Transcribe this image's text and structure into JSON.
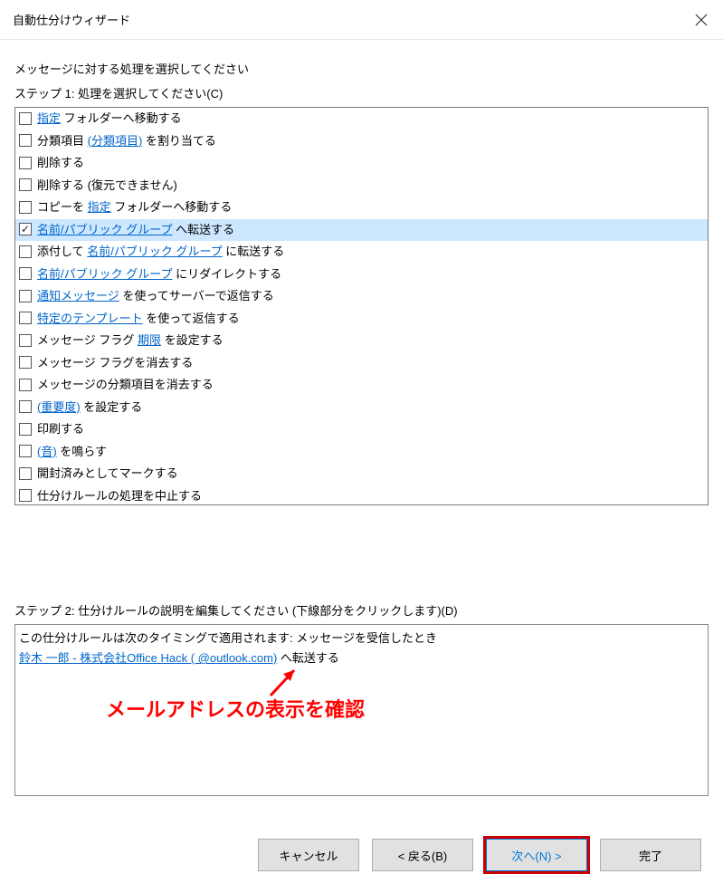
{
  "title": "自動仕分けウィザード",
  "instruction": "メッセージに対する処理を選択してください",
  "step1_label": "ステップ 1: 処理を選択してください(C)",
  "actions": [
    {
      "checked": false,
      "selected": false,
      "parts": [
        {
          "t": "link",
          "v": "指定"
        },
        {
          "t": "text",
          "v": " フォルダーへ移動する"
        }
      ]
    },
    {
      "checked": false,
      "selected": false,
      "parts": [
        {
          "t": "text",
          "v": "分類項目 "
        },
        {
          "t": "link",
          "v": "(分類項目)"
        },
        {
          "t": "text",
          "v": " を割り当てる"
        }
      ]
    },
    {
      "checked": false,
      "selected": false,
      "parts": [
        {
          "t": "text",
          "v": "削除する"
        }
      ]
    },
    {
      "checked": false,
      "selected": false,
      "parts": [
        {
          "t": "text",
          "v": "削除する (復元できません)"
        }
      ]
    },
    {
      "checked": false,
      "selected": false,
      "parts": [
        {
          "t": "text",
          "v": "コピーを "
        },
        {
          "t": "link",
          "v": "指定"
        },
        {
          "t": "text",
          "v": " フォルダーへ移動する"
        }
      ]
    },
    {
      "checked": true,
      "selected": true,
      "parts": [
        {
          "t": "link",
          "v": "名前/パブリック グループ"
        },
        {
          "t": "text",
          "v": " へ転送する"
        }
      ]
    },
    {
      "checked": false,
      "selected": false,
      "parts": [
        {
          "t": "text",
          "v": "添付して "
        },
        {
          "t": "link",
          "v": "名前/パブリック グループ"
        },
        {
          "t": "text",
          "v": " に転送する"
        }
      ]
    },
    {
      "checked": false,
      "selected": false,
      "parts": [
        {
          "t": "link",
          "v": "名前/パブリック グループ"
        },
        {
          "t": "text",
          "v": " にリダイレクトする"
        }
      ]
    },
    {
      "checked": false,
      "selected": false,
      "parts": [
        {
          "t": "link",
          "v": "通知メッセージ"
        },
        {
          "t": "text",
          "v": " を使ってサーバーで返信する"
        }
      ]
    },
    {
      "checked": false,
      "selected": false,
      "parts": [
        {
          "t": "link",
          "v": "特定のテンプレート"
        },
        {
          "t": "text",
          "v": " を使って返信する"
        }
      ]
    },
    {
      "checked": false,
      "selected": false,
      "parts": [
        {
          "t": "text",
          "v": "メッセージ フラグ "
        },
        {
          "t": "link",
          "v": "期限"
        },
        {
          "t": "text",
          "v": " を設定する"
        }
      ]
    },
    {
      "checked": false,
      "selected": false,
      "parts": [
        {
          "t": "text",
          "v": "メッセージ フラグを消去する"
        }
      ]
    },
    {
      "checked": false,
      "selected": false,
      "parts": [
        {
          "t": "text",
          "v": "メッセージの分類項目を消去する"
        }
      ]
    },
    {
      "checked": false,
      "selected": false,
      "parts": [
        {
          "t": "link",
          "v": "(重要度)"
        },
        {
          "t": "text",
          "v": " を設定する"
        }
      ]
    },
    {
      "checked": false,
      "selected": false,
      "parts": [
        {
          "t": "text",
          "v": "印刷する"
        }
      ]
    },
    {
      "checked": false,
      "selected": false,
      "parts": [
        {
          "t": "link",
          "v": "(音)"
        },
        {
          "t": "text",
          "v": " を鳴らす"
        }
      ]
    },
    {
      "checked": false,
      "selected": false,
      "parts": [
        {
          "t": "text",
          "v": "開封済みとしてマークする"
        }
      ]
    },
    {
      "checked": false,
      "selected": false,
      "parts": [
        {
          "t": "text",
          "v": "仕分けルールの処理を中止する"
        }
      ]
    }
  ],
  "step2_label": "ステップ 2: 仕分けルールの説明を編集してください (下線部分をクリックします)(D)",
  "desc": {
    "line1": "この仕分けルールは次のタイミングで適用されます: メッセージを受信したとき",
    "line2_link": "鈴木 一郎 - 株式会社Office Hack (                           @outlook.com)",
    "line2_after": " へ転送する"
  },
  "callout": "メールアドレスの表示を確認",
  "buttons": {
    "cancel": "キャンセル",
    "back": "< 戻る(B)",
    "next": "次へ(N) >",
    "finish": "完了"
  }
}
